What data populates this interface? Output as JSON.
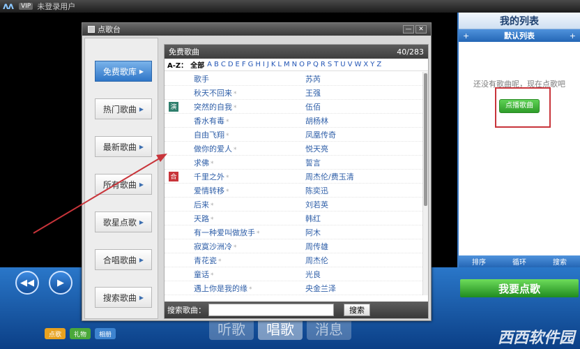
{
  "topbar": {
    "logo": "ᴧᴧ",
    "vip": "VIP",
    "user": "未登录用户"
  },
  "right_panel": {
    "title": "我的列表",
    "add": "+",
    "list_name": "默认列表",
    "add2": "+",
    "empty_text": "还没有歌曲呢，现在点歌吧",
    "order_button": "点播歌曲",
    "footer": [
      "排序",
      "循环",
      "搜索"
    ],
    "big_button": "我要点歌"
  },
  "player": {
    "prev": "◀◀",
    "play": "▶",
    "tabs": [
      "听歌",
      "唱歌",
      "消息"
    ],
    "mini_buttons": [
      "点歌",
      "礼物",
      "相册"
    ]
  },
  "dialog": {
    "title": "点歌台",
    "controls": [
      "—",
      "✕"
    ],
    "sidebar": [
      "免费歌库",
      "热门歌曲",
      "最新歌曲",
      "所有歌曲",
      "歌星点歌",
      "合唱歌曲",
      "搜索歌曲"
    ],
    "panel_title": "免费歌曲",
    "count": "40/283",
    "az_label": "A-Z：",
    "az_all": "全部",
    "letters": [
      "A",
      "B",
      "C",
      "D",
      "E",
      "F",
      "G",
      "H",
      "I",
      "J",
      "K",
      "L",
      "M",
      "N",
      "O",
      "P",
      "Q",
      "R",
      "S",
      "T",
      "U",
      "V",
      "W",
      "X",
      "Y",
      "Z"
    ],
    "songs": [
      {
        "title": "歌手",
        "artist": "苏芮",
        "star": false,
        "badge": ""
      },
      {
        "title": "秋天不回来",
        "artist": "王强",
        "star": true,
        "badge": ""
      },
      {
        "title": "突然的自我",
        "artist": "伍佰",
        "star": true,
        "badge": "演"
      },
      {
        "title": "香水有毒",
        "artist": "胡杨林",
        "star": true,
        "badge": ""
      },
      {
        "title": "自由飞翔",
        "artist": "凤凰传奇",
        "star": true,
        "badge": ""
      },
      {
        "title": "做你的爱人",
        "artist": "悦天亮",
        "star": true,
        "badge": ""
      },
      {
        "title": "求佛",
        "artist": "誓言",
        "star": true,
        "badge": ""
      },
      {
        "title": "千里之外",
        "artist": "周杰伦/费玉清",
        "star": true,
        "badge": "合"
      },
      {
        "title": "爱情转移",
        "artist": "陈奕迅",
        "star": true,
        "badge": ""
      },
      {
        "title": "后来",
        "artist": "刘若英",
        "star": true,
        "badge": ""
      },
      {
        "title": "天路",
        "artist": "韩红",
        "star": true,
        "badge": ""
      },
      {
        "title": "有一种爱叫做放手",
        "artist": "阿木",
        "star": true,
        "badge": ""
      },
      {
        "title": "寂寞沙洲冷",
        "artist": "周传雄",
        "star": true,
        "badge": ""
      },
      {
        "title": "青花瓷",
        "artist": "周杰伦",
        "star": true,
        "badge": ""
      },
      {
        "title": "童话",
        "artist": "光良",
        "star": true,
        "badge": ""
      },
      {
        "title": "遇上你是我的缘",
        "artist": "央金兰泽",
        "star": true,
        "badge": ""
      }
    ],
    "search_label": "搜索歌曲：",
    "search_value": "",
    "search_button": "搜索"
  },
  "watermark": "西西软件园",
  "colors": {
    "accent": "#2f76c8",
    "green": "#2f9d2a",
    "red_box": "#c8343a"
  }
}
